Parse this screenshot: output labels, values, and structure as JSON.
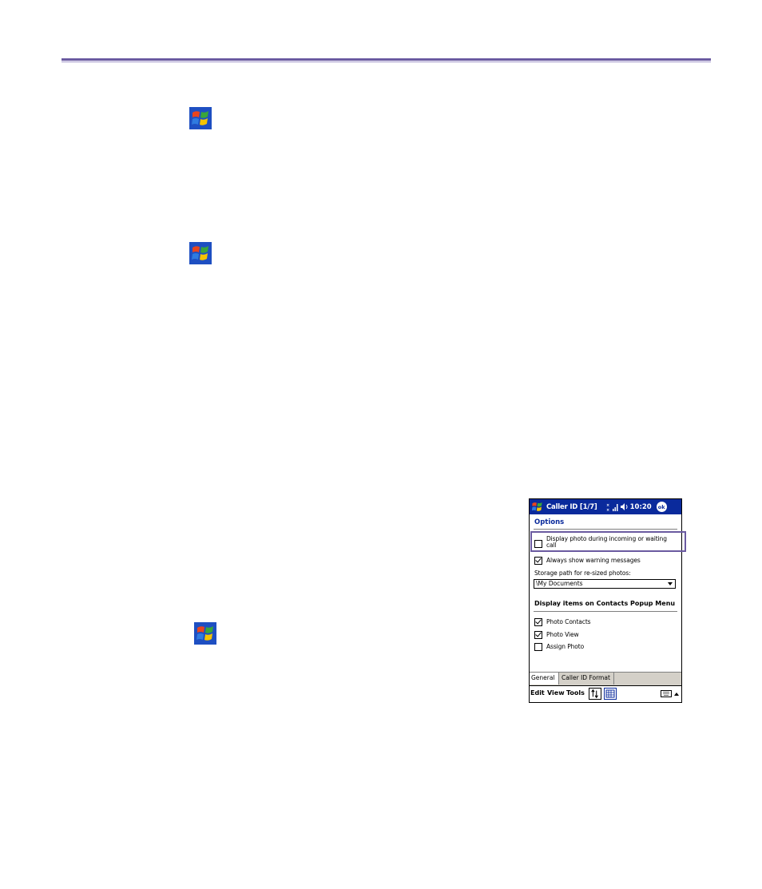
{
  "document": {
    "icons": [
      "windows-start-icon",
      "windows-start-icon",
      "windows-start-icon"
    ]
  },
  "screenshot": {
    "title": "Caller ID [1/7]",
    "time": "10:20",
    "ok_label": "ok",
    "heading": "Options",
    "options": [
      {
        "label": "Display photo during incoming or waiting call",
        "checked": false
      },
      {
        "label": "Always show warning messages",
        "checked": true
      }
    ],
    "storage_label": "Storage path for re-sized photos:",
    "storage_value": "\\My Documents",
    "popup_heading": "Display items on Contacts Popup Menu",
    "popup_items": [
      {
        "label": "Photo Contacts",
        "checked": true
      },
      {
        "label": "Photo View",
        "checked": true
      },
      {
        "label": "Assign Photo",
        "checked": false
      }
    ],
    "tabs": [
      "General",
      "Caller ID Format"
    ],
    "menu": [
      "Edit",
      "View",
      "Tools"
    ]
  }
}
